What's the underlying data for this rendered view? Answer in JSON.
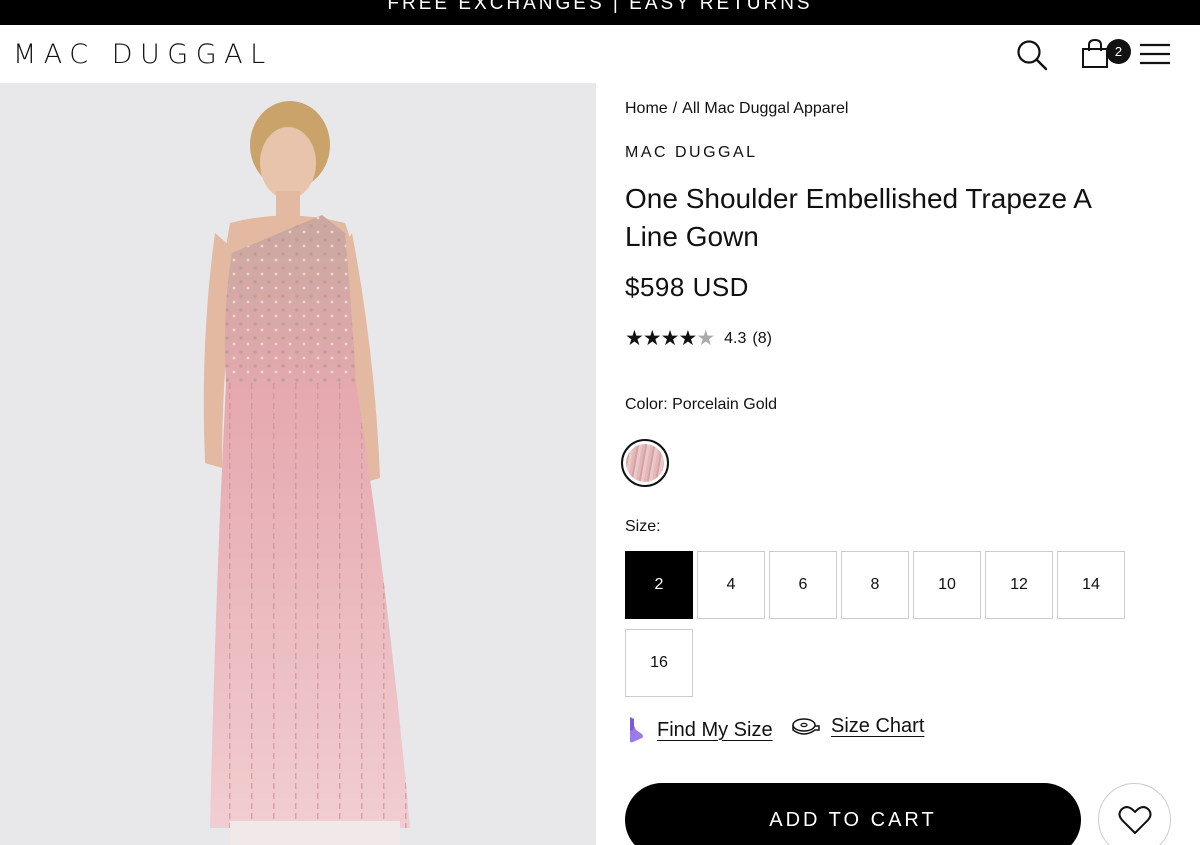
{
  "promo": {
    "text": "FREE EXCHANGES | EASY RETURNS"
  },
  "header": {
    "logo": "MAC DUGGAL",
    "icons": {
      "search": "search-icon",
      "bag": "shopping-bag-icon",
      "menu": "hamburger-menu-icon"
    },
    "bag_count": "2"
  },
  "product_image": {
    "alt": "Model wearing pink one shoulder embellished gown"
  },
  "breadcrumb": {
    "home": "Home",
    "separator": "/",
    "category": "All Mac Duggal Apparel"
  },
  "product": {
    "brand": "MAC DUGGAL",
    "title": "One Shoulder Embellished Trapeze A Line Gown",
    "price": "$598 USD",
    "rating": {
      "stars_filled": "★★★★",
      "stars_empty": "★",
      "value": "4.3",
      "count": "(8)"
    }
  },
  "color": {
    "label": "Color: Porcelain Gold",
    "swatch_colors": [
      "#e3b8b9",
      "#d7a2a5",
      "#ecc8c8"
    ]
  },
  "size": {
    "label": "Size:",
    "options": [
      "2",
      "4",
      "6",
      "8",
      "10",
      "12",
      "14",
      "16"
    ],
    "selected": "2"
  },
  "links": {
    "find_my_size": "Find My Size",
    "size_chart": "Size Chart",
    "find_icon_color": "#9b7be8"
  },
  "cart": {
    "add_label": "ADD TO CART"
  },
  "colors": {
    "accent": "#000000",
    "image_bg": "#e8e8ea",
    "dress_pink": "#e9b3b8"
  }
}
